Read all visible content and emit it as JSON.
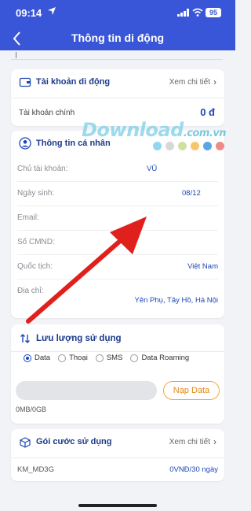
{
  "status": {
    "time": "09:14",
    "battery": "95"
  },
  "header": {
    "title": "Thông tin di động"
  },
  "account_card": {
    "title": "Tài khoản di động",
    "link": "Xem chi tiết",
    "main_label": "Tài khoản chính",
    "main_value": "0 đ"
  },
  "watermark": {
    "text": "Download",
    "suffix": ".com.vn"
  },
  "personal_card": {
    "title": "Thông tin cá nhân",
    "rows": [
      {
        "label": "Chủ tài khoản:",
        "value": "VŨ"
      },
      {
        "label": "Ngày sinh:",
        "value": "08/12"
      },
      {
        "label": "Email:",
        "value": ""
      },
      {
        "label": "Số CMND:",
        "value": ""
      },
      {
        "label": "Quốc tịch:",
        "value": "Việt Nam"
      },
      {
        "label": "Địa chỉ:",
        "value": "Yên Phụ, Tây Hồ, Hà Nội"
      }
    ]
  },
  "usage_card": {
    "title": "Lưu lượng sử dụng",
    "options": [
      "Data",
      "Thoại",
      "SMS",
      "Data Roaming"
    ],
    "selected": "Data",
    "button": "Nạp Data",
    "usage": "0MB/0GB"
  },
  "plan_card": {
    "title": "Gói cước sử dụng",
    "link": "Xem chi tiết",
    "plan_name": "KM_MD3G",
    "plan_price": "0VNĐ/30 ngày"
  },
  "colors": {
    "header_blue": "#3a56d8",
    "value_blue": "#1d47b8",
    "accent_orange": "#f0a93a",
    "arrow_red": "#e0201c",
    "dots": [
      "#8fd6f0",
      "#d8d8d8",
      "#cfe0a2",
      "#f6c76a",
      "#5aa6e6",
      "#f08a8a"
    ]
  },
  "icons": [
    "location-arrow-icon",
    "cellular-signal-icon",
    "wifi-icon",
    "battery-icon",
    "back-chevron-icon",
    "wallet-icon",
    "user-circle-icon",
    "transfer-arrows-icon",
    "package-icon",
    "chevron-right-icon"
  ]
}
